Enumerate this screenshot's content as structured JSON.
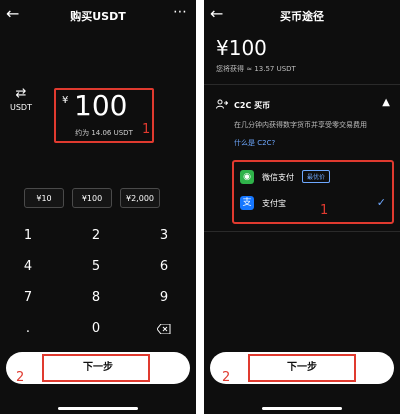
{
  "left_screen": {
    "title": "购买USDT",
    "back_icon": "back-arrow-icon",
    "more_icon": "more-icon",
    "swap_label": "USDT",
    "currency_sign": "¥",
    "amount": "100",
    "approx": "约为 14.06 USDT",
    "annotation_1": "1",
    "presets": [
      "¥10",
      "¥100",
      "¥2,000"
    ],
    "keys": [
      "1",
      "2",
      "3",
      "4",
      "5",
      "6",
      "7",
      "8",
      "9",
      ".",
      "0"
    ],
    "backspace_icon": "backspace-icon",
    "next_button": "下一步",
    "annotation_2": "2"
  },
  "right_screen": {
    "title": "买币途径",
    "back_icon": "back-arrow-icon",
    "amount": "¥100",
    "receive": "您将获得 ≈ 13.57 USDT",
    "c2c_title": "C2C 买币",
    "c2c_description": "在几分钟内获得数字货币并享受零交易费用",
    "c2c_link": "什么是 C2C?",
    "wechat_label": "微信支付",
    "wechat_badge": "最优价",
    "alipay_label": "支付宝",
    "annotation_1": "1",
    "next_button": "下一步",
    "annotation_2": "2"
  },
  "colors": {
    "background": "#0e0e0e",
    "annotation": "#e03a2f",
    "accent": "#6ea8ff",
    "wechat": "#2fb34a",
    "alipay": "#1677ff"
  }
}
